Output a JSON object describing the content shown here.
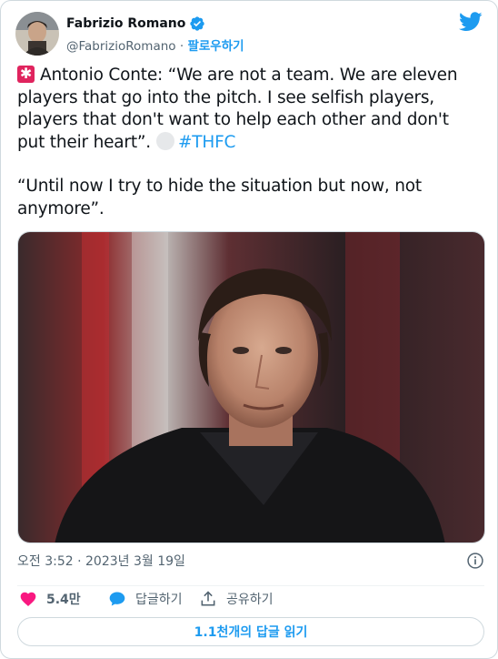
{
  "author": {
    "name": "Fabrizio Romano",
    "handle": "@FabrizioRomano",
    "separator": "·",
    "follow_label": "팔로우하기"
  },
  "tweet": {
    "line1_text": "Antonio Conte: “We are not a team. We are eleven players that go into the pitch. I see selfish players, players that don't want to help each other and don't put their heart”.",
    "hashtag": "#THFC",
    "line2_text": "“Until now I try to hide the situation but now, not anymore”."
  },
  "timestamp": "오전 3:52 · 2023년 3월 19일",
  "actions": {
    "like_count": "5.4만",
    "reply_label": "답글하기",
    "share_label": "공유하기"
  },
  "read_replies_label": "1.1천개의 답글 읽기",
  "icons": {
    "verified": "verified-badge-icon",
    "brand": "twitter-bird-icon",
    "info": "info-icon",
    "like": "heart-icon",
    "reply": "speech-bubble-icon",
    "share": "share-upload-icon"
  },
  "colors": {
    "accent": "#1d9bf0",
    "like": "#f91880",
    "text": "#0f1419",
    "secondary": "#536471"
  }
}
